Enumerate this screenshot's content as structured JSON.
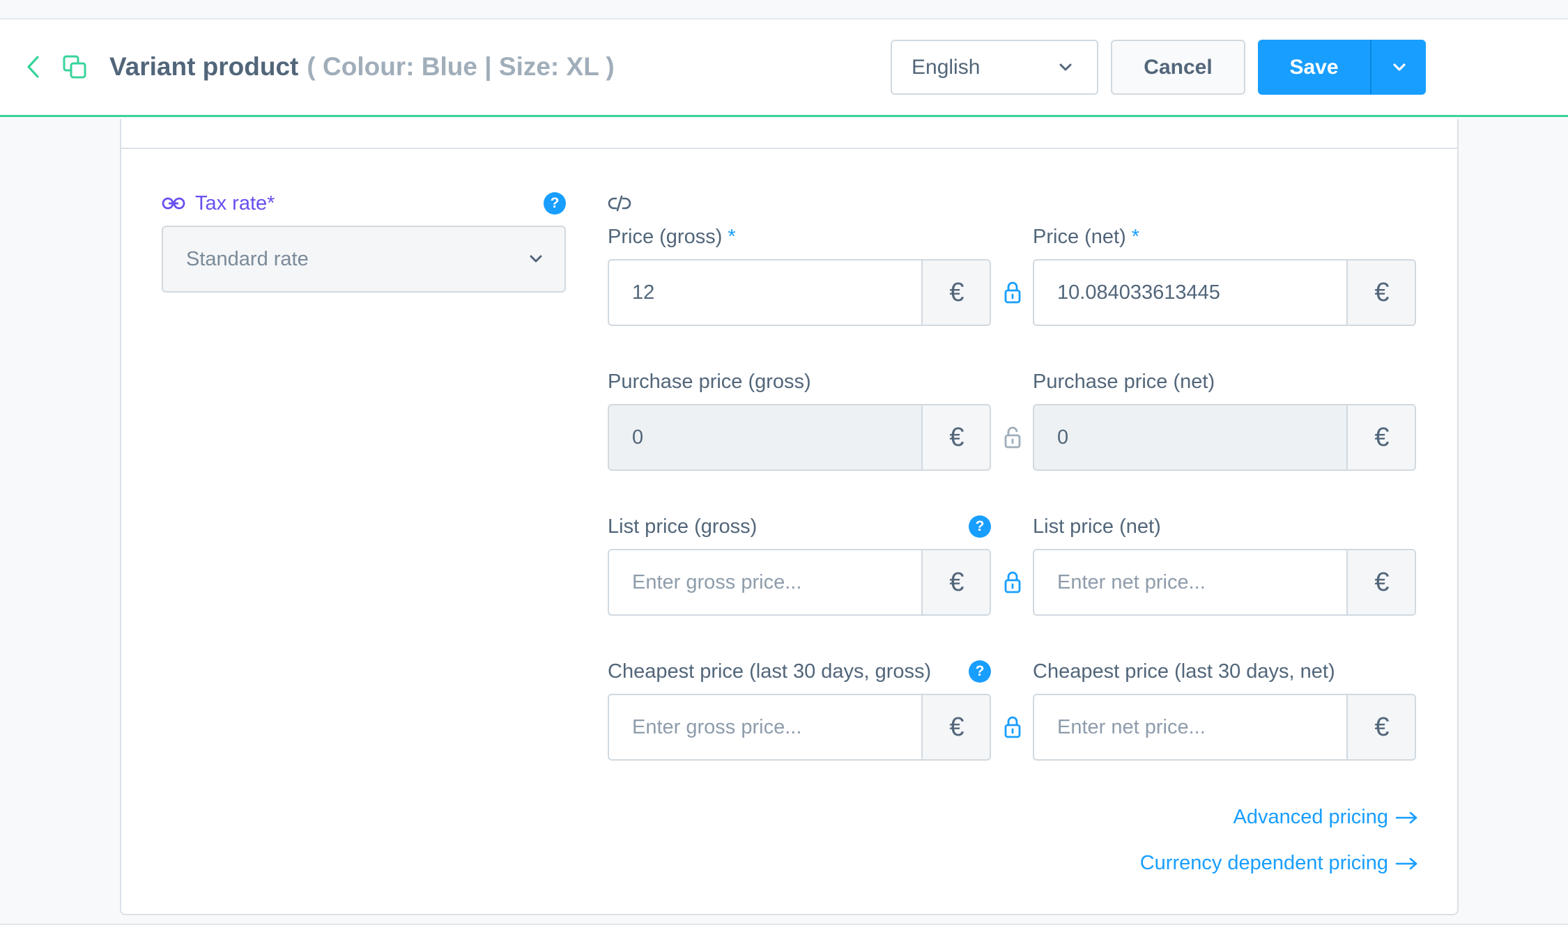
{
  "header": {
    "title": "Variant product",
    "variant_info": "( Colour: Blue | Size: XL )",
    "language": "English",
    "cancel_label": "Cancel",
    "save_label": "Save"
  },
  "tax": {
    "label": "Tax rate",
    "required_mark": "*",
    "help": "?",
    "value": "Standard rate"
  },
  "prices": {
    "required_mark": "*",
    "currency_symbol": "€",
    "help": "?",
    "price_gross": {
      "label": "Price (gross)",
      "value": "12"
    },
    "price_net": {
      "label": "Price (net)",
      "value": "10.084033613445"
    },
    "purchase_gross": {
      "label": "Purchase price (gross)",
      "value": "0"
    },
    "purchase_net": {
      "label": "Purchase price (net)",
      "value": "0"
    },
    "list_gross": {
      "label": "List price (gross)",
      "value": "",
      "placeholder": "Enter gross price..."
    },
    "list_net": {
      "label": "List price (net)",
      "value": "",
      "placeholder": "Enter net price..."
    },
    "cheapest_gross": {
      "label": "Cheapest price (last 30 days, gross)",
      "value": "",
      "placeholder": "Enter gross price..."
    },
    "cheapest_net": {
      "label": "Cheapest price (last 30 days, net)",
      "value": "",
      "placeholder": "Enter net price..."
    }
  },
  "links": {
    "advanced_pricing": "Advanced pricing",
    "currency_pricing": "Currency dependent pricing"
  },
  "colors": {
    "accent": "#189eff",
    "success_line": "#37d49a",
    "inherit": "#6750f0"
  },
  "icons": {
    "back": "chevron-left-icon",
    "variant": "copy-icon",
    "tax_inherit": "link-icon",
    "price_inherit": "unlink-icon",
    "locked": "lock-icon",
    "unlocked": "lock-open-icon",
    "arrow": "arrow-right-icon"
  }
}
